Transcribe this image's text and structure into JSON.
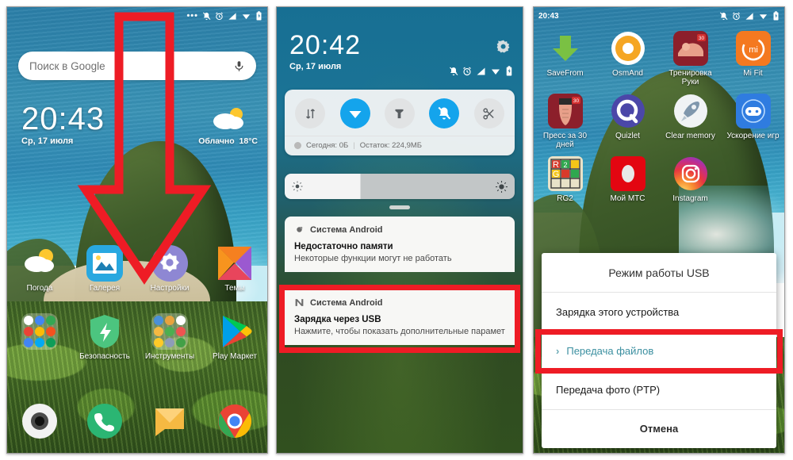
{
  "panel1": {
    "name": "home-screen",
    "statusbar": {
      "icons": [
        "overflow-dots",
        "bell-off-icon",
        "alarm-icon",
        "signal-icon",
        "wifi-icon",
        "battery-charging-icon"
      ]
    },
    "search": {
      "placeholder": "Поиск в Google",
      "mic": "mic-icon"
    },
    "clock": {
      "time": "20:43",
      "date": "Ср, 17 июля"
    },
    "weather": {
      "condition": "Облачно",
      "temp": "18°C"
    },
    "apps_row1": [
      {
        "label": "Погода",
        "icon": "weather-icon"
      },
      {
        "label": "Галерея",
        "icon": "gallery-icon"
      },
      {
        "label": "Настройки",
        "icon": "settings-icon"
      },
      {
        "label": "Темы",
        "icon": "themes-icon"
      }
    ],
    "apps_row2": [
      {
        "label": "",
        "icon": "google-folder-icon"
      },
      {
        "label": "Безопасность",
        "icon": "security-icon"
      },
      {
        "label": "Инструменты",
        "icon": "tools-folder-icon"
      },
      {
        "label": "Play Маркет",
        "icon": "play-store-icon"
      }
    ],
    "dock": [
      {
        "label": "",
        "icon": "camera-icon"
      },
      {
        "label": "",
        "icon": "phone-icon"
      },
      {
        "label": "",
        "icon": "messages-icon"
      },
      {
        "label": "",
        "icon": "chrome-icon"
      }
    ],
    "annotation": {
      "shape": "red-down-arrow",
      "color": "#ee1c25"
    }
  },
  "panel2": {
    "name": "notification-shade",
    "clock": {
      "time": "20:42",
      "date": "Ср, 17 июля"
    },
    "gear": "settings-gear-icon",
    "statusbar": {
      "icons": [
        "bell-off-icon",
        "alarm-icon",
        "signal-icon",
        "wifi-icon",
        "battery-charging-icon"
      ]
    },
    "toggles": [
      {
        "name": "data-usage-toggle",
        "icon": "data-arrows-icon",
        "active": false
      },
      {
        "name": "wifi-toggle",
        "icon": "wifi-icon",
        "active": true
      },
      {
        "name": "flashlight-toggle",
        "icon": "flashlight-icon",
        "active": false
      },
      {
        "name": "silent-toggle",
        "icon": "bell-off-icon",
        "active": true
      },
      {
        "name": "screenshot-toggle",
        "icon": "scissors-icon",
        "active": false
      }
    ],
    "data_usage": {
      "today_label": "Сегодня: 0Б",
      "separator": "|",
      "remaining_label": "Остаток: 224,9МБ"
    },
    "brightness": {
      "level_percent": 33,
      "low_icon": "brightness-low-icon",
      "high_icon": "brightness-high-icon"
    },
    "notifications": [
      {
        "app": "Система Android",
        "app_icon": "android-system-icon",
        "title": "Недостаточно памяти",
        "body": "Некоторые функции могут не работать",
        "highlighted": false
      },
      {
        "app": "Система Android",
        "app_icon": "android-n-icon",
        "title": "Зарядка через USB",
        "body": "Нажмите, чтобы показать дополнительные параметр..",
        "highlighted": true
      }
    ]
  },
  "panel3": {
    "name": "app-drawer-with-usb-dialog",
    "statusbar": {
      "time": "20:43",
      "icons": [
        "bell-off-icon",
        "alarm-icon",
        "signal-icon",
        "wifi-icon",
        "battery-charging-icon"
      ]
    },
    "apps_row1": [
      {
        "label": "SaveFrom",
        "icon": "savefrom-icon"
      },
      {
        "label": "OsmAnd",
        "icon": "osmand-icon"
      },
      {
        "label": "Тренировка Руки",
        "icon": "arm-workout-icon"
      },
      {
        "label": "Mi Fit",
        "icon": "mifit-icon"
      }
    ],
    "apps_row2": [
      {
        "label": "Пресс за 30 дней",
        "icon": "abs-workout-icon"
      },
      {
        "label": "Quizlet",
        "icon": "quizlet-icon"
      },
      {
        "label": "Clear memory",
        "icon": "rocket-icon"
      },
      {
        "label": "Ускорение игр",
        "icon": "game-turbo-icon"
      }
    ],
    "apps_row3": [
      {
        "label": "RG2",
        "icon": "rubiks-cube-icon"
      },
      {
        "label": "Мой МТС",
        "icon": "mts-icon"
      },
      {
        "label": "Instagram",
        "icon": "instagram-icon"
      }
    ],
    "dialog": {
      "title": "Режим работы USB",
      "options": [
        {
          "label": "Зарядка этого устройства",
          "selected": false
        },
        {
          "label": "Передача файлов",
          "selected": true
        },
        {
          "label": "Передача фото (PTP)",
          "selected": false
        }
      ],
      "cancel": "Отмена"
    }
  },
  "colors": {
    "accent_red": "#ee1c25",
    "accent_blue": "#14a4ec",
    "dialog_selected": "#3b8fa0"
  }
}
